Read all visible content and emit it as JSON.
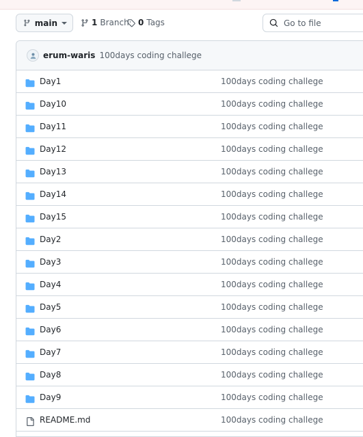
{
  "toolbar": {
    "branch_label": "main",
    "branches_count": "1",
    "branches_label": "Branch",
    "tags_count": "0",
    "tags_label": "Tags",
    "search_placeholder": "Go to file"
  },
  "commit": {
    "author": "erum-waris",
    "message": "100days coding challege"
  },
  "files": [
    {
      "name": "Day1",
      "type": "folder",
      "message": "100days coding challege"
    },
    {
      "name": "Day10",
      "type": "folder",
      "message": "100days coding challege"
    },
    {
      "name": "Day11",
      "type": "folder",
      "message": "100days coding challege"
    },
    {
      "name": "Day12",
      "type": "folder",
      "message": "100days coding challege"
    },
    {
      "name": "Day13",
      "type": "folder",
      "message": "100days coding challege"
    },
    {
      "name": "Day14",
      "type": "folder",
      "message": "100days coding challege"
    },
    {
      "name": "Day15",
      "type": "folder",
      "message": "100days coding challege"
    },
    {
      "name": "Day2",
      "type": "folder",
      "message": "100days coding challege"
    },
    {
      "name": "Day3",
      "type": "folder",
      "message": "100days coding challege"
    },
    {
      "name": "Day4",
      "type": "folder",
      "message": "100days coding challege"
    },
    {
      "name": "Day5",
      "type": "folder",
      "message": "100days coding challege"
    },
    {
      "name": "Day6",
      "type": "folder",
      "message": "100days coding challege"
    },
    {
      "name": "Day7",
      "type": "folder",
      "message": "100days coding challege"
    },
    {
      "name": "Day8",
      "type": "folder",
      "message": "100days coding challege"
    },
    {
      "name": "Day9",
      "type": "folder",
      "message": "100days coding challege"
    },
    {
      "name": "README.md",
      "type": "file",
      "message": "100days coding challege"
    }
  ],
  "colors": {
    "folder": "#54aeff",
    "border": "#d0d7de",
    "muted_text": "#57606a"
  },
  "icons": {
    "branch": "git-branch-icon",
    "tag": "tag-icon",
    "search": "search-icon",
    "folder": "folder-icon",
    "file": "file-icon"
  }
}
